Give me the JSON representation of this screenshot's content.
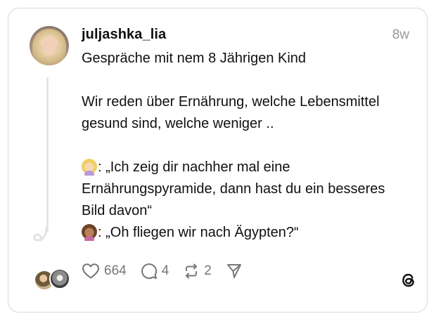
{
  "post": {
    "username": "juljashka_lia",
    "timestamp": "8w",
    "title": "Gespräche mit nem 8 Jährigen Kind",
    "paragraph": "Wir reden über Ernährung, welche Lebensmittel gesund sind, welche weniger ..",
    "quote_mother": ": „Ich zeig dir nachher mal eine Ernährungspyramide, dann hast du ein besseres Bild davon“",
    "quote_child": ": „Oh fliegen wir nach Ägypten?“"
  },
  "actions": {
    "likes": "664",
    "replies": "4",
    "reposts": "2"
  },
  "icons": {
    "like": "heart-icon",
    "reply": "comment-icon",
    "repost": "repost-icon",
    "share": "send-icon",
    "brand": "threads-logo-icon"
  }
}
